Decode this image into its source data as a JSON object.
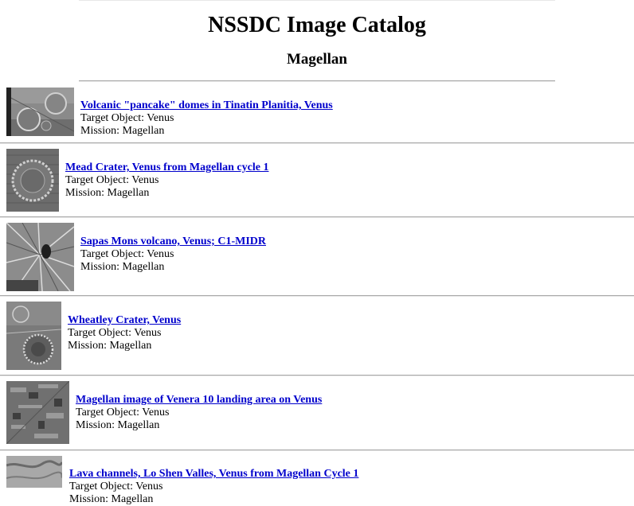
{
  "page": {
    "title": "NSSDC Image Catalog",
    "subtitle": "Magellan"
  },
  "entries": [
    {
      "link": "Volcanic \"pancake\" domes in Tinatin Planitia, Venus",
      "target": "Target Object: Venus",
      "mission": "Mission: Magellan",
      "thumb_icon": "venus-pancake-domes-thumbnail"
    },
    {
      "link": "Mead Crater, Venus from Magellan cycle 1",
      "target": "Target Object: Venus",
      "mission": "Mission: Magellan",
      "thumb_icon": "mead-crater-thumbnail"
    },
    {
      "link": "Sapas Mons volcano, Venus; C1-MIDR",
      "target": "Target Object: Venus",
      "mission": "Mission: Magellan",
      "thumb_icon": "sapas-mons-thumbnail"
    },
    {
      "link": "Wheatley Crater, Venus",
      "target": "Target Object: Venus",
      "mission": "Mission: Magellan",
      "thumb_icon": "wheatley-crater-thumbnail"
    },
    {
      "link": "Magellan image of Venera 10 landing area on Venus",
      "target": "Target Object: Venus",
      "mission": "Mission: Magellan",
      "thumb_icon": "venera-10-landing-area-thumbnail"
    },
    {
      "link": "Lava channels, Lo Shen Valles, Venus from Magellan Cycle 1",
      "target": "Target Object: Venus",
      "mission": "Mission: Magellan",
      "thumb_icon": "lo-shen-valles-thumbnail"
    }
  ]
}
